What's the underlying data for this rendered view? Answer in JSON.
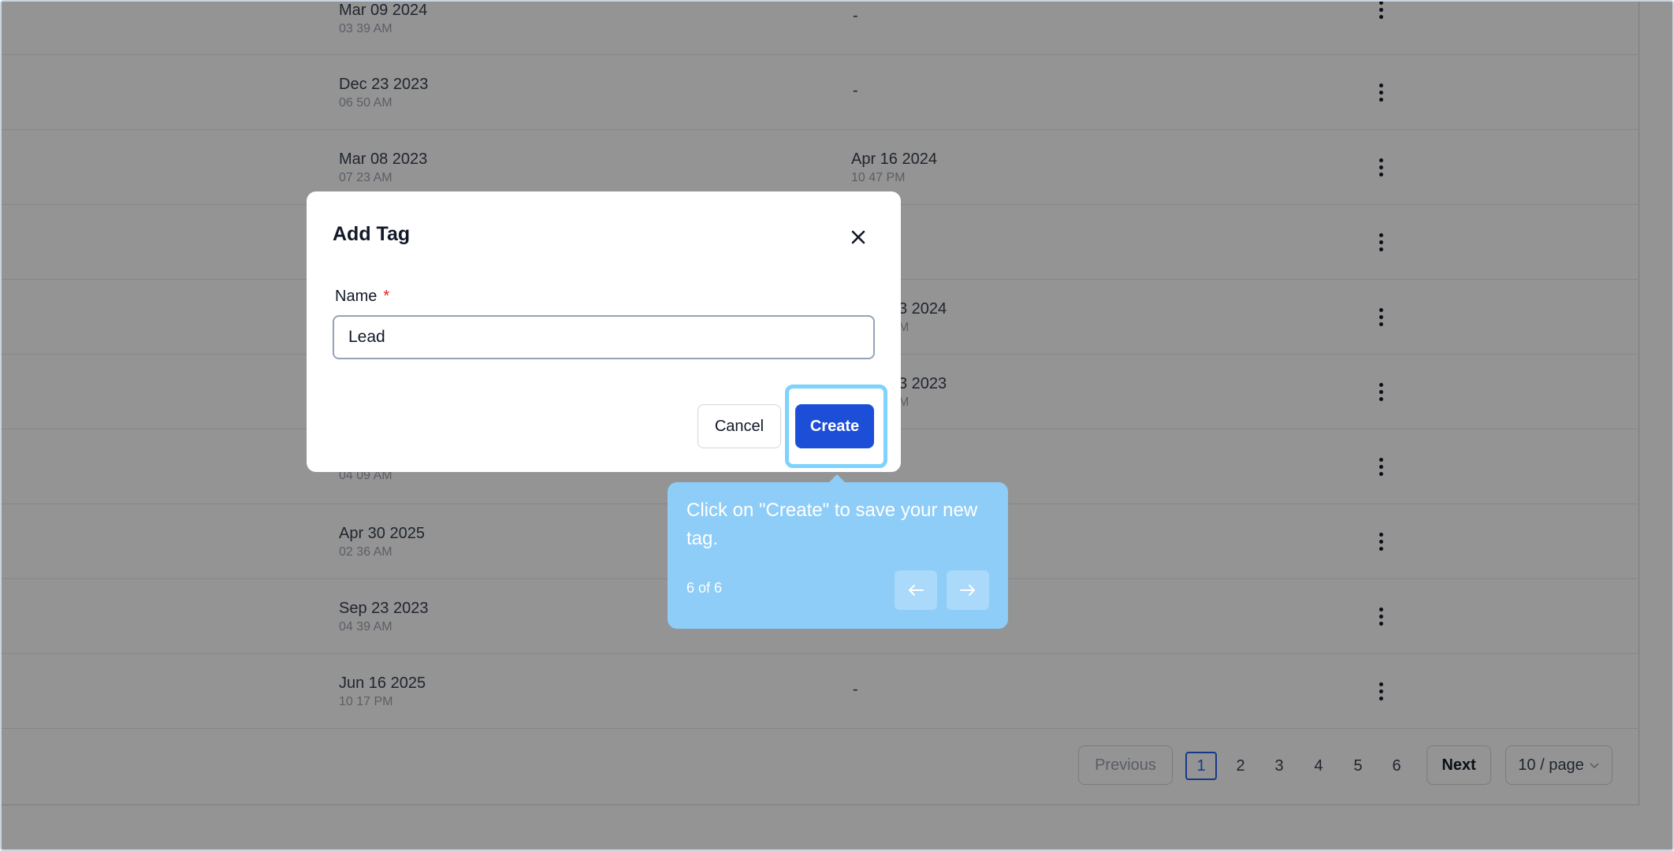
{
  "table": {
    "rows": [
      {
        "created_date": "Mar 09 2024",
        "created_time": "03 39 AM",
        "updated_date": "-",
        "updated_time": ""
      },
      {
        "created_date": "Dec 23 2023",
        "created_time": "06 50 AM",
        "updated_date": "-",
        "updated_time": ""
      },
      {
        "created_date": "Mar 08 2023",
        "created_time": "07 23 AM",
        "updated_date": "Apr 16 2024",
        "updated_time": "10 47 PM"
      },
      {
        "created_date": "",
        "created_time": "",
        "updated_date": "",
        "updated_time": ""
      },
      {
        "created_date": "",
        "created_time": "",
        "updated_date": "3 2024",
        "updated_time": "M"
      },
      {
        "created_date": "",
        "created_time": "",
        "updated_date": "3 2023",
        "updated_time": "M"
      },
      {
        "created_date": "",
        "created_time": "04 09 AM",
        "updated_date": "",
        "updated_time": ""
      },
      {
        "created_date": "Apr 30 2025",
        "created_time": "02 36 AM",
        "updated_date": "",
        "updated_time": ""
      },
      {
        "created_date": "Sep 23 2023",
        "created_time": "04 39 AM",
        "updated_date": "",
        "updated_time": ""
      },
      {
        "created_date": "Jun 16 2025",
        "created_time": "10 17 PM",
        "updated_date": "-",
        "updated_time": ""
      }
    ]
  },
  "pagination": {
    "previous_label": "Previous",
    "pages": [
      "1",
      "2",
      "3",
      "4",
      "5",
      "6"
    ],
    "active_page": "1",
    "next_label": "Next",
    "page_size_label": "10 / page",
    "page_size_icon": "chevron-down-icon"
  },
  "modal": {
    "title": "Add Tag",
    "close_icon": "close-icon",
    "name_label": "Name",
    "required_marker": "*",
    "name_value": "Lead",
    "cancel_label": "Cancel",
    "create_label": "Create"
  },
  "tour": {
    "text": "Click on \"Create\" to save your new tag.",
    "step": "6 of 6",
    "prev_icon": "arrow-left-icon",
    "next_icon": "arrow-right-icon"
  },
  "colors": {
    "primary": "#1d4ed8",
    "tooltip_bg": "#8ecdf8",
    "highlight": "#7dd3fc",
    "required": "#dc2626"
  }
}
